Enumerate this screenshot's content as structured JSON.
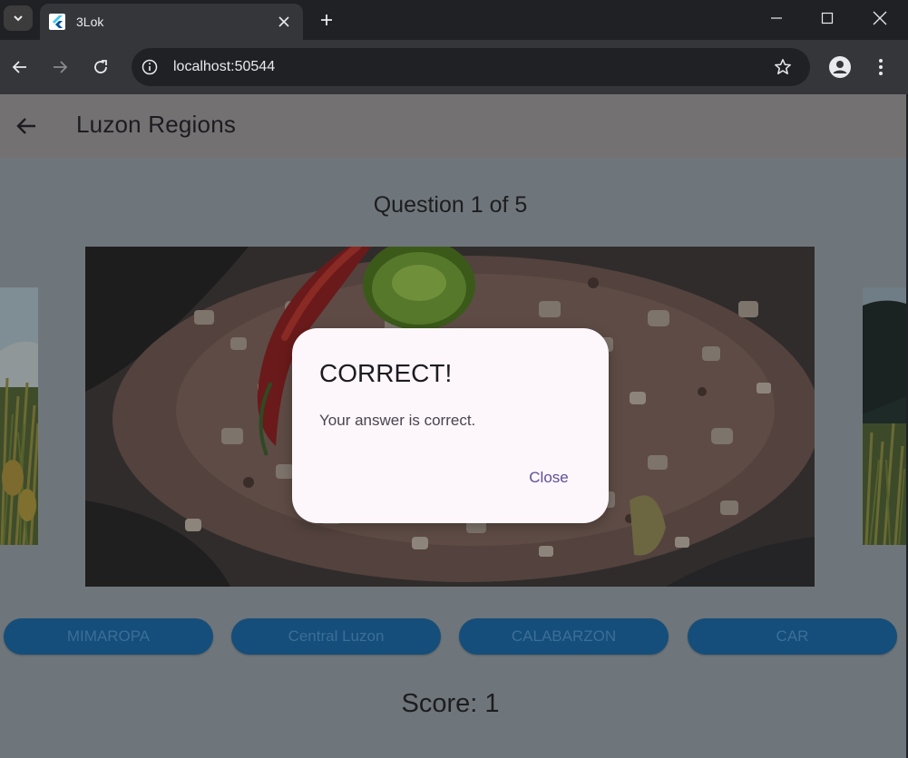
{
  "browser": {
    "tab_title": "3Lok",
    "url": "localhost:50544"
  },
  "app": {
    "title": "Luzon Regions",
    "question_label": "Question 1 of 5",
    "score_label": "Score: 1",
    "answers": [
      {
        "label": "MIMAROPA"
      },
      {
        "label": "Central Luzon"
      },
      {
        "label": "CALABARZON"
      },
      {
        "label": "CAR"
      }
    ]
  },
  "dialog": {
    "title": "CORRECT!",
    "message": "Your answer is correct.",
    "close_label": "Close"
  },
  "colors": {
    "overlay_bg": "#6f767b",
    "appbar_bg": "#737172",
    "answer_button_bg": "#154e7a",
    "dialog_bg": "#fdf7fc",
    "dialog_action": "#5f4f96"
  },
  "icons": {
    "tab_search": "chevron-down-icon",
    "favicon": "flutter-logo-icon",
    "tab_close": "close-icon",
    "new_tab": "plus-icon",
    "minimize": "minimize-icon",
    "maximize": "maximize-icon",
    "window_close": "close-icon",
    "back": "arrow-left-icon",
    "forward": "arrow-right-icon",
    "reload": "reload-icon",
    "site_info": "info-icon",
    "bookmark": "star-icon",
    "profile": "person-icon",
    "menu": "kebab-menu-icon",
    "app_back": "arrow-left-icon"
  }
}
